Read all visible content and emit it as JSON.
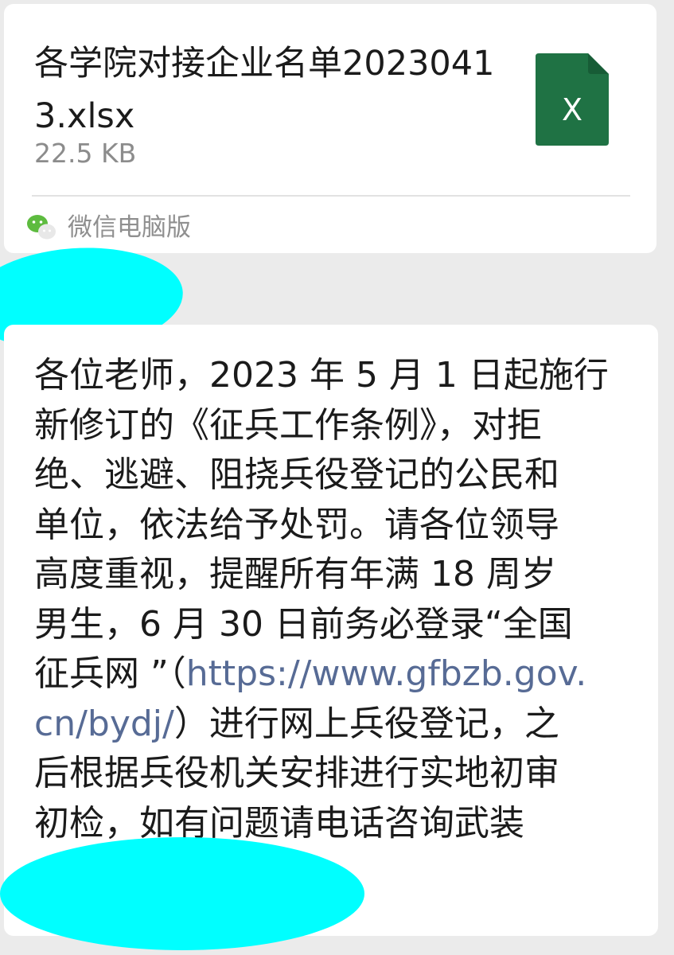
{
  "file_message": {
    "file_name": "各学院对接企业名单20230413.xlsx",
    "file_size": "22.5 KB",
    "file_icon": "excel-file-icon",
    "file_icon_letter": "X",
    "file_icon_color": "#1f7244",
    "source_icon": "wechat-icon",
    "source_label": "微信电脑版"
  },
  "text_message": {
    "part1": "各位老师，2023 年 5 月 1 日起施行\n新修订的《征兵工作条例》，对拒\n绝、逃避、阻挠兵役登记的公民和\n单位，依法给予处罚。请各位领导\n高度重视，提醒所有年满 18 周岁\n男生，6 月 30 日前务必登录“全国\n征兵网 ”（",
    "link": "https://www.gfbzb.gov.\ncn/bydj/",
    "part2": "）进行网上兵役登记，之\n后根据兵役机关安排进行实地初审\n初检，如有问题请电话咨询武装",
    "link_color": "#576b95"
  },
  "redaction_color": "#00ffff"
}
